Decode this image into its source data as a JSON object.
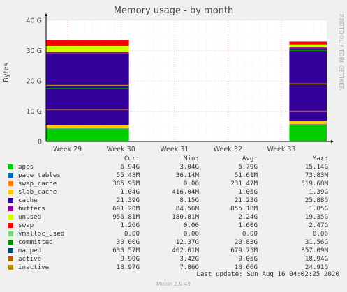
{
  "chart_data": {
    "type": "area",
    "title": "Memory usage - by month",
    "ylabel": "Bytes",
    "side_label": "RRDTOOL / TOBI OETIKER",
    "y_ticks": [
      "0",
      "10 G",
      "20 G",
      "30 G",
      "40 G"
    ],
    "ylim": [
      0,
      40
    ],
    "y_unit": "G",
    "x_ticks": [
      "Week 29",
      "Week 30",
      "Week 31",
      "Week 32",
      "Week 33"
    ],
    "x_tick_pos": [
      29,
      30,
      31,
      32,
      33
    ],
    "xlim": [
      28.6,
      33.85
    ],
    "data_ranges": [
      [
        28.6,
        30.15
      ],
      [
        33.15,
        33.85
      ]
    ],
    "stack": [
      {
        "name": "apps",
        "color": "#00cc00",
        "y": [
          4.2,
          5.5
        ]
      },
      {
        "name": "page_tables",
        "color": "#0066b3",
        "y": [
          4.3,
          5.6
        ]
      },
      {
        "name": "swap_cache",
        "color": "#ff8000",
        "y": [
          4.5,
          5.8
        ]
      },
      {
        "name": "slab_cache",
        "color": "#ffcc00",
        "y": [
          5.5,
          6.8
        ]
      },
      {
        "name": "cache",
        "color": "#330099",
        "y": [
          29.0,
          30.5
        ]
      },
      {
        "name": "buffers",
        "color": "#990099",
        "y": [
          29.5,
          31.0
        ]
      },
      {
        "name": "unused",
        "color": "#ccff00",
        "y": [
          31.5,
          32.0
        ]
      },
      {
        "name": "swap",
        "color": "#ff0000",
        "y": [
          33.5,
          33.0
        ]
      }
    ],
    "lines": [
      {
        "name": "committed",
        "color": "#008f00",
        "y": [
          17.5,
          30.0
        ]
      },
      {
        "name": "active",
        "color": "#b35a00",
        "y": [
          10.5,
          10.0
        ]
      },
      {
        "name": "inactive",
        "color": "#b38f00",
        "y": [
          18.5,
          19.0
        ]
      }
    ],
    "legend_header": {
      "cur": "Cur:",
      "min": "Min:",
      "avg": "Avg:",
      "max": "Max:"
    },
    "legend": [
      {
        "name": "apps",
        "color": "#00cc00",
        "cur": "6.94G",
        "min": "3.04G",
        "avg": "5.79G",
        "max": "15.14G"
      },
      {
        "name": "page_tables",
        "color": "#0066b3",
        "cur": "55.48M",
        "min": "36.14M",
        "avg": "51.61M",
        "max": "73.83M"
      },
      {
        "name": "swap_cache",
        "color": "#ff8000",
        "cur": "385.95M",
        "min": "0.00",
        "avg": "231.47M",
        "max": "519.68M"
      },
      {
        "name": "slab_cache",
        "color": "#ffcc00",
        "cur": "1.04G",
        "min": "416.04M",
        "avg": "1.05G",
        "max": "1.39G"
      },
      {
        "name": "cache",
        "color": "#330099",
        "cur": "21.39G",
        "min": "8.15G",
        "avg": "21.23G",
        "max": "25.88G"
      },
      {
        "name": "buffers",
        "color": "#990099",
        "cur": "691.20M",
        "min": "84.56M",
        "avg": "855.18M",
        "max": "1.05G"
      },
      {
        "name": "unused",
        "color": "#ccff00",
        "cur": "956.81M",
        "min": "180.81M",
        "avg": "2.24G",
        "max": "19.35G"
      },
      {
        "name": "swap",
        "color": "#ff0000",
        "cur": "1.26G",
        "min": "0.00",
        "avg": "1.60G",
        "max": "2.47G"
      },
      {
        "name": "vmalloc_used",
        "color": "#7fd67f",
        "cur": "0.00",
        "min": "0.00",
        "avg": "0.00",
        "max": "0.00"
      },
      {
        "name": "committed",
        "color": "#008f00",
        "cur": "30.00G",
        "min": "12.37G",
        "avg": "20.83G",
        "max": "31.56G"
      },
      {
        "name": "mapped",
        "color": "#00487d",
        "cur": "630.57M",
        "min": "462.01M",
        "avg": "679.75M",
        "max": "857.09M"
      },
      {
        "name": "active",
        "color": "#b35a00",
        "cur": "9.99G",
        "min": "3.42G",
        "avg": "9.05G",
        "max": "18.94G"
      },
      {
        "name": "inactive",
        "color": "#b38f00",
        "cur": "18.97G",
        "min": "7.86G",
        "avg": "18.66G",
        "max": "24.91G"
      }
    ]
  },
  "footer": {
    "last_update": "Last update: Sun Aug 16 04:02:25 2020",
    "version": "Munin 2.0.49"
  }
}
